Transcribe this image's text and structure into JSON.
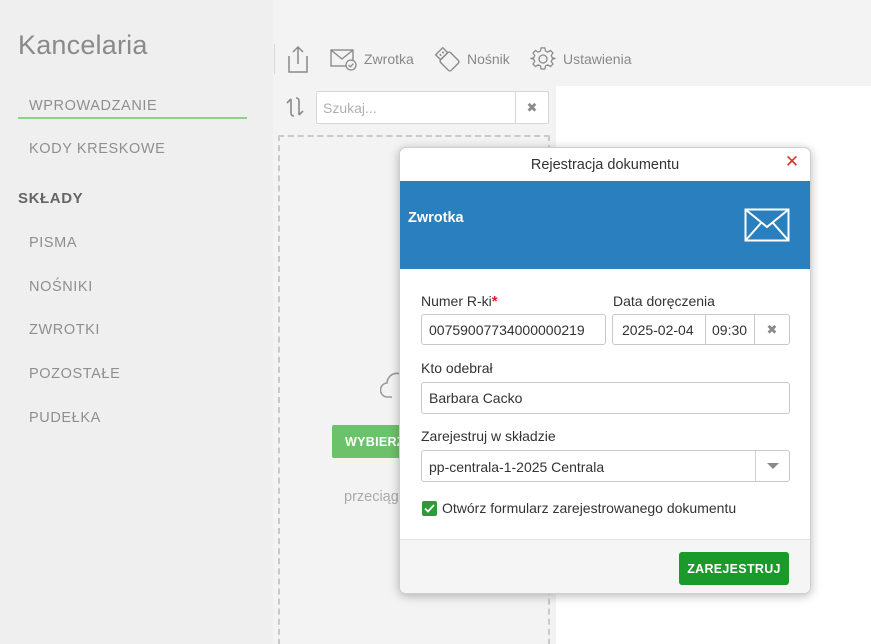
{
  "sidebar": {
    "app_title": "Kancelaria",
    "items": [
      {
        "label": "WPROWADZANIE"
      },
      {
        "label": "KODY KRESKOWE"
      }
    ],
    "section_title": "SKŁADY",
    "section_items": [
      {
        "label": "PISMA"
      },
      {
        "label": "NOŚNIKI"
      },
      {
        "label": "ZWROTKI"
      },
      {
        "label": "POZOSTAŁE"
      },
      {
        "label": "PUDEŁKA"
      }
    ]
  },
  "toolbar": {
    "zwrotka_label": "Zwrotka",
    "nosnik_label": "Nośnik",
    "ustawienia_label": "Ustawienia"
  },
  "search": {
    "placeholder": "Szukaj..."
  },
  "dropzone": {
    "choose_label": "WYBIERZ",
    "drag_text": "przeciąg"
  },
  "modal": {
    "title": "Rejestracja dokumentu",
    "banner_title": "Zwrotka",
    "fields": {
      "numer_label": "Numer R-ki",
      "numer_required": "*",
      "numer_value": "00759007734000000219",
      "data_label": "Data doręczenia",
      "data_date": "2025-02-04",
      "data_time": "09:30",
      "kto_label": "Kto odebrał",
      "kto_value": "Barbara Cacko",
      "sklad_label": "Zarejestruj w składzie",
      "sklad_value": "pp-centrala-1-2025 Centrala"
    },
    "checkbox_label": "Otwórz formularz zarejestrowanego dokumentu",
    "checkbox_checked": true,
    "register_label": "ZAREJESTRUJ"
  },
  "colors": {
    "banner": "#2a7fbe",
    "primary_button": "#1a9a2a",
    "sidebar_active_underline": "#8fd18a",
    "required": "#e02020",
    "close": "#d9342b"
  }
}
